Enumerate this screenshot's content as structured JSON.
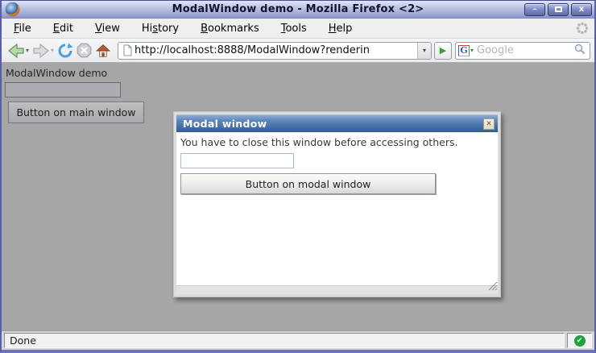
{
  "window": {
    "title": "ModalWindow demo - Mozilla Firefox <2>",
    "controls": {
      "minimize": "–",
      "close": "x"
    }
  },
  "menubar": {
    "items": [
      {
        "label": "File",
        "accel": 0
      },
      {
        "label": "Edit",
        "accel": 0
      },
      {
        "label": "View",
        "accel": 0
      },
      {
        "label": "History",
        "accel": 2
      },
      {
        "label": "Bookmarks",
        "accel": 0
      },
      {
        "label": "Tools",
        "accel": 0
      },
      {
        "label": "Help",
        "accel": 0
      }
    ]
  },
  "toolbar": {
    "url_value": "http://localhost:8888/ModalWindow?renderin",
    "url_dropdown_glyph": "▾",
    "go_glyph": "▶",
    "back_dropdown_glyph": "▾",
    "forward_dropdown_glyph": "▾",
    "search_engine_letter": "G",
    "search_dropdown_glyph": "▾",
    "search_placeholder": "Google",
    "search_value": ""
  },
  "page": {
    "heading": "ModalWindow demo",
    "text_input_value": "",
    "main_button_label": "Button on main window"
  },
  "modal": {
    "title": "Modal window",
    "close_glyph": "✕",
    "message": "You have to close this window before accessing others.",
    "text_input_value": "",
    "button_label": "Button on modal window"
  },
  "statusbar": {
    "text": "Done",
    "ok_glyph": "✔"
  },
  "colors": {
    "titlebar_blue": "#8d96c8",
    "modal_title_blue": "#315c96",
    "status_ok_green": "#1fa33c",
    "dimmed_page_gray": "#a6a6a6"
  }
}
